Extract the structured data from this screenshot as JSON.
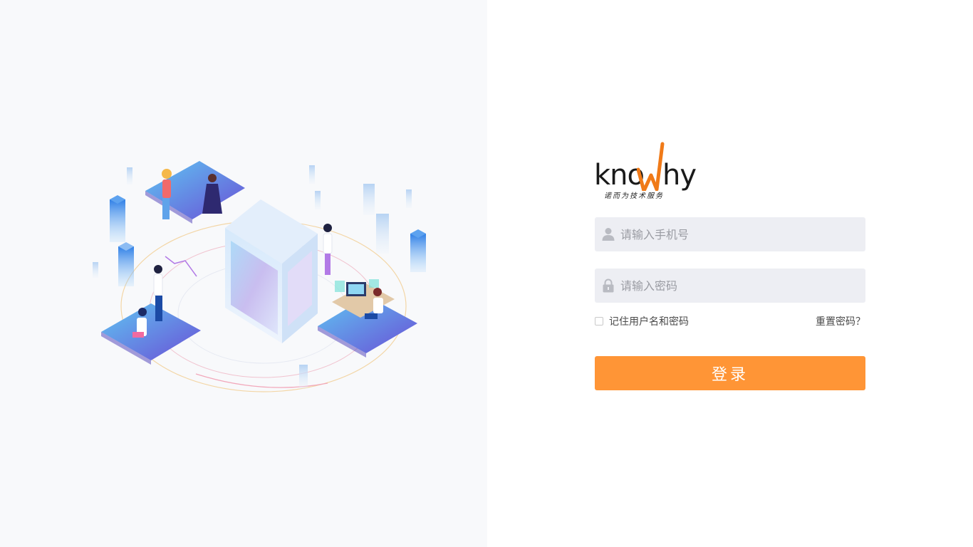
{
  "logo": {
    "wordmark_prefix": "kno",
    "wordmark_suffix": "hy",
    "tagline": "诺而为技术服务"
  },
  "login_form": {
    "phone_placeholder": "请输入手机号",
    "phone_value": "",
    "phone_icon": "user-icon",
    "password_placeholder": "请输入密码",
    "password_value": "",
    "password_icon": "lock-icon",
    "remember_label": "记住用户名和密码",
    "remember_checked": false,
    "reset_password_label": "重置密码？",
    "submit_label": "登录"
  },
  "colors": {
    "accent": "#ff9536",
    "logo_w": "#f07a18",
    "field_bg": "#edeef3",
    "left_bg": "#f8f9fb"
  }
}
